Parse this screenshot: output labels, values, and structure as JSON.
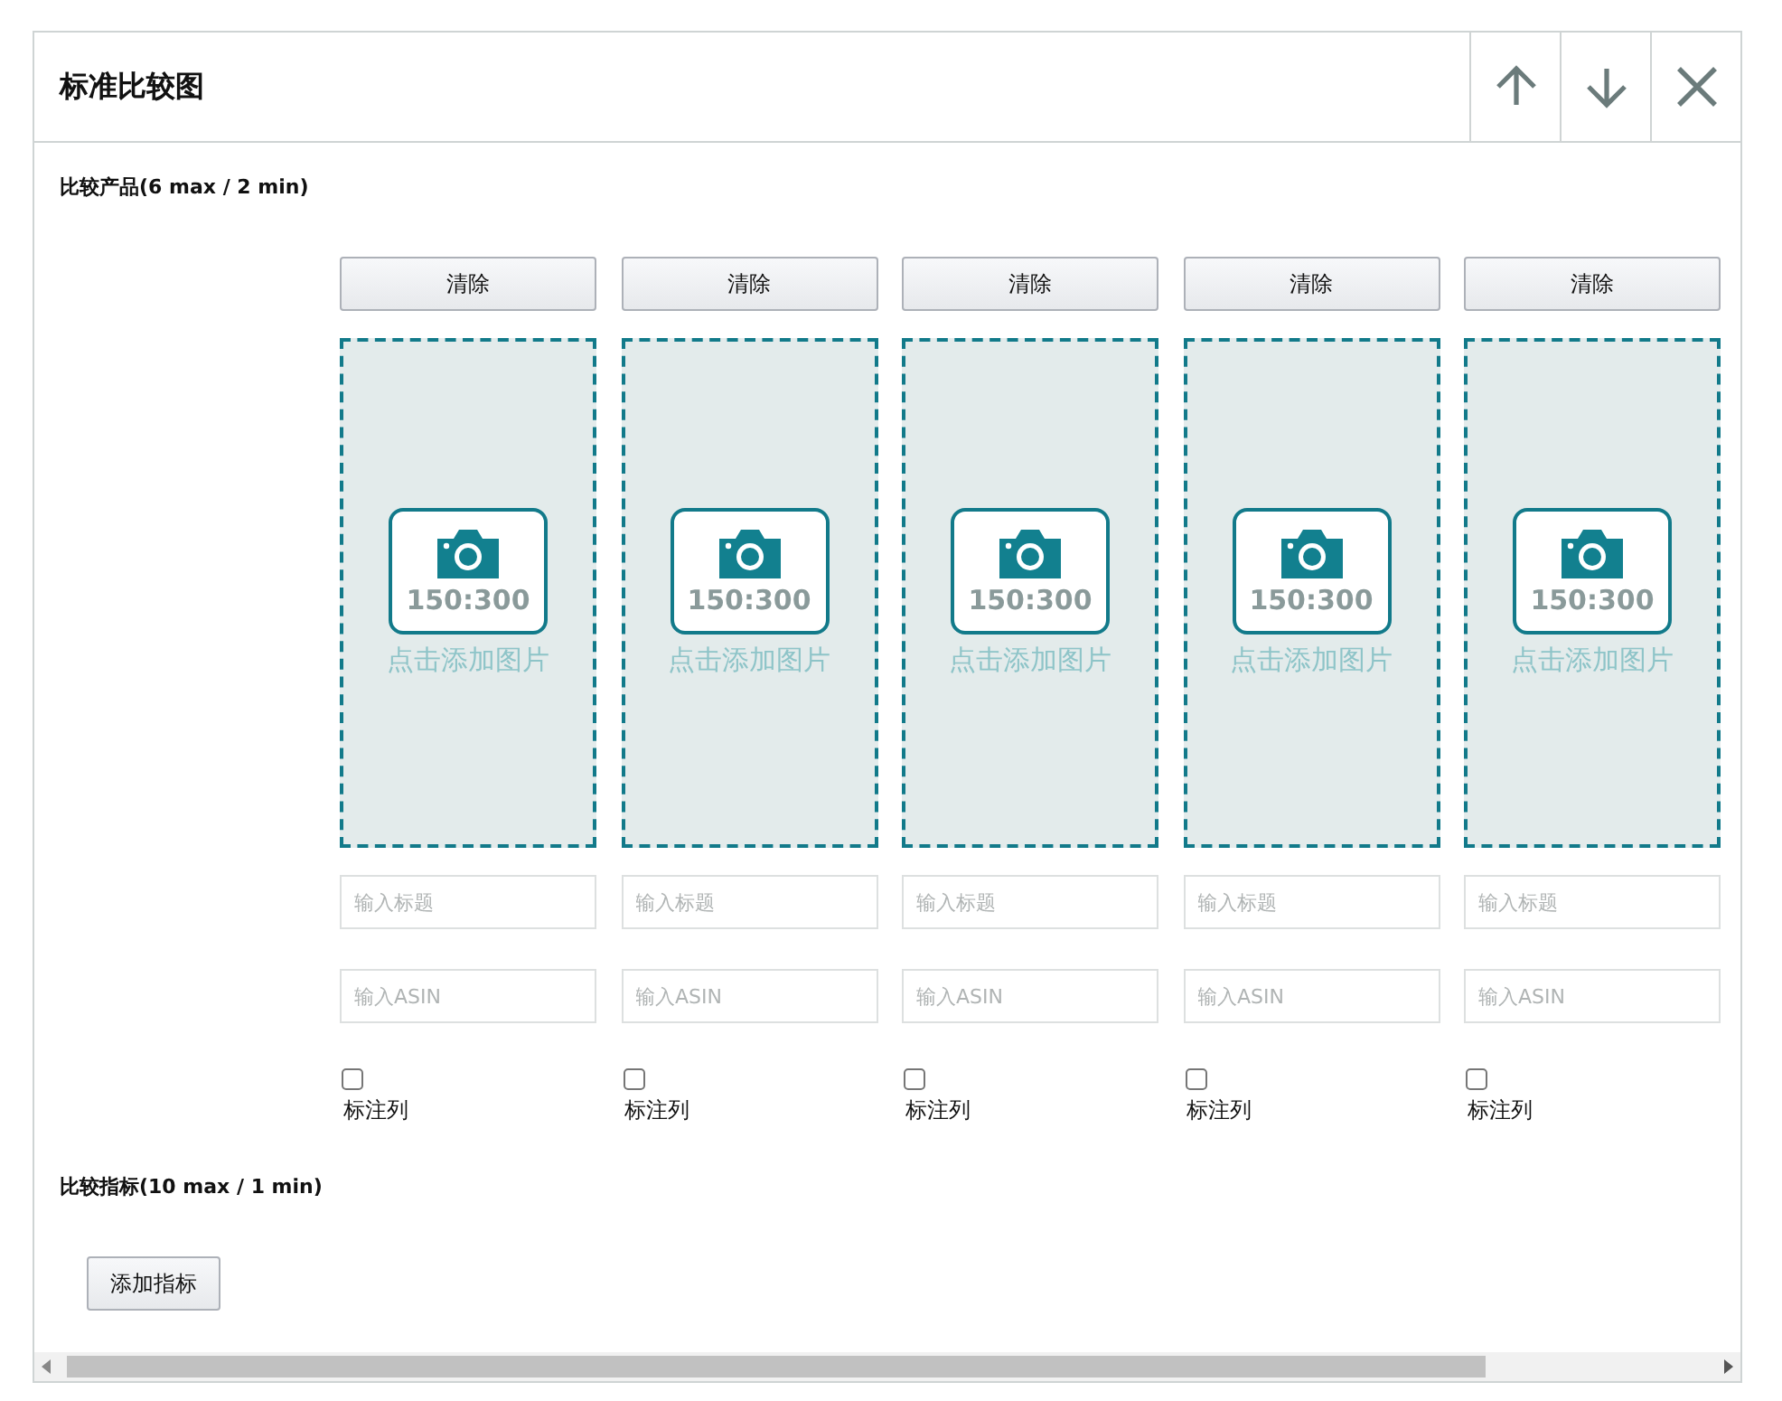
{
  "panel": {
    "title": "标准比较图"
  },
  "products": {
    "label": "比较产品(6 max / 2 min)",
    "items": [
      {
        "clear_button": "清除",
        "ratio": "150:300",
        "image_hint": "点击添加图片",
        "title_placeholder": "输入标题",
        "asin_placeholder": "输入ASIN",
        "checkbox_label": "标注列",
        "checked": false
      },
      {
        "clear_button": "清除",
        "ratio": "150:300",
        "image_hint": "点击添加图片",
        "title_placeholder": "输入标题",
        "asin_placeholder": "输入ASIN",
        "checkbox_label": "标注列",
        "checked": false
      },
      {
        "clear_button": "清除",
        "ratio": "150:300",
        "image_hint": "点击添加图片",
        "title_placeholder": "输入标题",
        "asin_placeholder": "输入ASIN",
        "checkbox_label": "标注列",
        "checked": false
      },
      {
        "clear_button": "清除",
        "ratio": "150:300",
        "image_hint": "点击添加图片",
        "title_placeholder": "输入标题",
        "asin_placeholder": "输入ASIN",
        "checkbox_label": "标注列",
        "checked": false
      },
      {
        "clear_button": "清除",
        "ratio": "150:300",
        "image_hint": "点击添加图片",
        "title_placeholder": "输入标题",
        "asin_placeholder": "输入ASIN",
        "checkbox_label": "标注列",
        "checked": false
      }
    ]
  },
  "metrics": {
    "label": "比较指标(10 max / 1 min)",
    "add_button": "添加指标"
  }
}
